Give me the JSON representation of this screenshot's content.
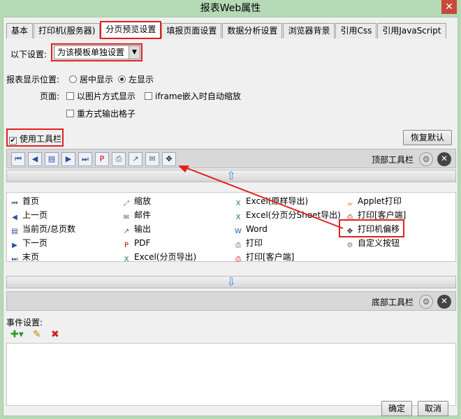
{
  "window": {
    "title": "报表Web属性",
    "close": "✕"
  },
  "tabs": [
    "基本",
    "打印机(服务器)",
    "分页预览设置",
    "填报页面设置",
    "数据分析设置",
    "浏览器背景",
    "引用Css",
    "引用JavaScript"
  ],
  "settings": {
    "label": "以下设置:",
    "select_value": "为该模板单独设置",
    "position_label": "报表显示位置:",
    "radio_center": "居中显示",
    "radio_left": "左显示",
    "page_label": "页面:",
    "chk_image": "以图片方式显示",
    "chk_iframe": "iframe嵌入时自动缩放",
    "chk_repeat": "重方式输出格子",
    "use_toolbar": "使用工具栏",
    "restore_default": "恢复默认"
  },
  "top_toolbar": {
    "label": "顶部工具栏",
    "icons": [
      "first-page-icon",
      "prev-page-icon",
      "current-total-icon",
      "next-page-icon",
      "last-page-icon",
      "pdf-icon",
      "print-icon",
      "export-icon",
      "mail-icon",
      "move-icon"
    ]
  },
  "bottom_toolbar": {
    "label": "底部工具栏"
  },
  "grid": {
    "col1": [
      "首页",
      "上一页",
      "当前页/总页数",
      "下一页",
      "末页"
    ],
    "col2": [
      "缩放",
      "邮件",
      "输出",
      "PDF",
      "Excel(分页导出)"
    ],
    "col3": [
      "Excel(原样导出)",
      "Excel(分页分Sheet导出)",
      "Word",
      "打印",
      "打印[客户端]"
    ],
    "col4": [
      "Applet打印",
      "打印[客户端]",
      "打印机偏移",
      "自定义按钮"
    ]
  },
  "events": {
    "label": "事件设置:"
  },
  "footer": {
    "ok": "确定",
    "cancel": "取消"
  }
}
